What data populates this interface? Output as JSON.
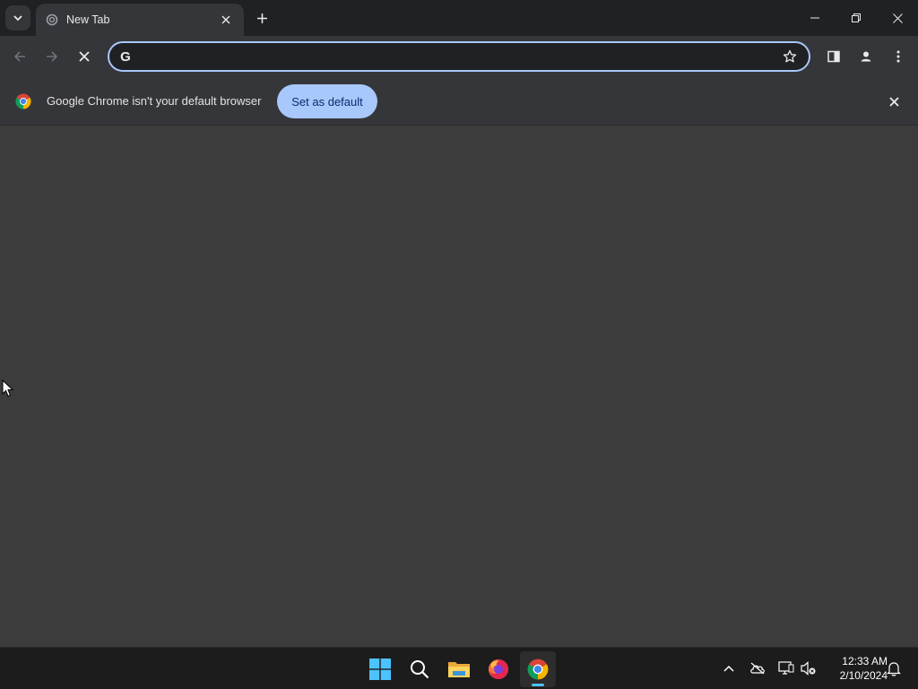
{
  "tab": {
    "title": "New Tab"
  },
  "toolbar": {
    "omnibox_value": "",
    "omnibox_placeholder": ""
  },
  "infobar": {
    "message": "Google Chrome isn't your default browser",
    "button_label": "Set as default"
  },
  "taskbar": {
    "apps": [
      "windows-start",
      "search",
      "file-explorer",
      "firefox",
      "chrome"
    ],
    "active_app": "chrome",
    "time": "12:33 AM",
    "date": "2/10/2024"
  },
  "colors": {
    "accent": "#a8c7fa",
    "taskbar_indicator": "#4cc2ff",
    "content_bg": "#3c3c3c"
  }
}
